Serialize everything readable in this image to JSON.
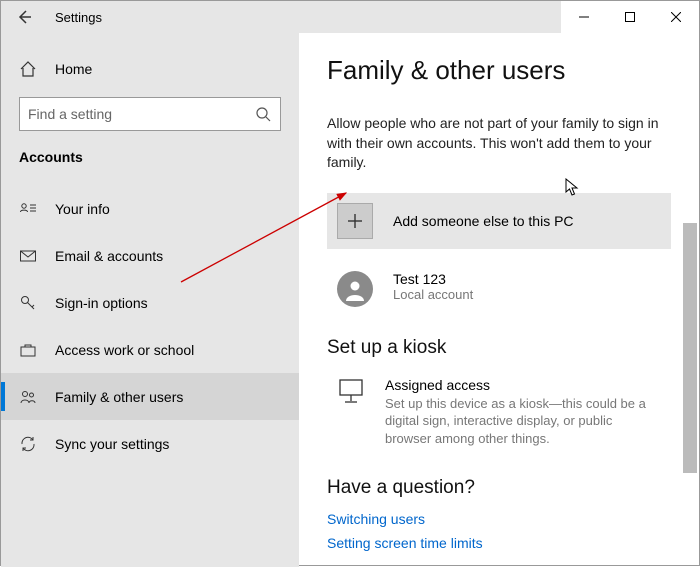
{
  "window": {
    "title": "Settings"
  },
  "sidebar": {
    "home_label": "Home",
    "search_placeholder": "Find a setting",
    "section": "Accounts",
    "items": [
      {
        "id": "your-info",
        "label": "Your info"
      },
      {
        "id": "email-accounts",
        "label": "Email & accounts"
      },
      {
        "id": "sign-in-options",
        "label": "Sign-in options"
      },
      {
        "id": "access-work-school",
        "label": "Access work or school"
      },
      {
        "id": "family-other-users",
        "label": "Family & other users"
      },
      {
        "id": "sync-settings",
        "label": "Sync your settings"
      }
    ]
  },
  "main": {
    "title": "Family & other users",
    "description": "Allow people who are not part of your family to sign in with their own accounts. This won't add them to your family.",
    "add_label": "Add someone else to this PC",
    "user": {
      "name": "Test 123",
      "subtitle": "Local account"
    },
    "kiosk": {
      "heading": "Set up a kiosk",
      "title": "Assigned access",
      "description": "Set up this device as a kiosk—this could be a digital sign, interactive display, or public browser among other things."
    },
    "question": {
      "heading": "Have a question?",
      "links": [
        "Switching users",
        "Setting screen time limits"
      ]
    }
  }
}
